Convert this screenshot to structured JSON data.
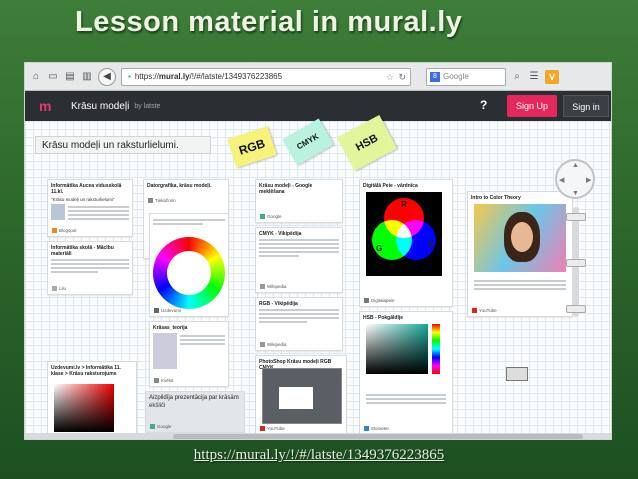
{
  "slide": {
    "title": "Lesson material in mural.ly",
    "caption_url": "https://mural.ly/!/#/latste/1349376223865"
  },
  "browser": {
    "url_prefix": "https://",
    "url_domain": "mural.ly",
    "url_rest": "/!/#/latste/1349376223865",
    "search_placeholder": "Google",
    "search_engine_letter": "8"
  },
  "mural": {
    "board_name": "Krāsu modeļi",
    "by": "by latste",
    "help": "?",
    "signup": "Sign Up",
    "signin": "Sign in",
    "board_title": "Krāsu modeļi un raksturlielumi.",
    "stickies": [
      "RGB",
      "CMYK",
      "HSB"
    ],
    "cards": {
      "c1_title": "Informātika Aucea vidusskolā 11.kl.",
      "c1_sub": "\"Krāsu modeļi un raksturlielumi\"",
      "c1_src": "Blogspot",
      "c2_title": "Informātika skolā - Mācību materiāli",
      "c2_src": "Lilu",
      "c3_title": "Datorgrafika, krāsu modeļi.",
      "c3_src": "Tiekažorin",
      "c4_src": "Uzdevumi",
      "c5_title": "Krāsas_teorija",
      "c5_src": "Kvēlot",
      "c6_title": "Krāsu modeļi - Google meklēšana",
      "c6_src": "Google",
      "c7_title": "CMYK - Vikipēdija",
      "c7_src": "Wikipedia",
      "c8_title": "RGB - Vikipēdija",
      "c8_src": "Wikipedia",
      "c9_title": "PhotoShop Krāsu modeļi RGB CMYK",
      "c9_src": "YouTube",
      "c10_title": "Digitālā Peie - vārdnīca",
      "c10_src": "Digitalapeie",
      "c11_title": "HSB - Pokgāldīje",
      "c11_src": "Slometer",
      "c12_title": "Intro to Color Theory",
      "c12_src": "YouTube",
      "c13_title": "Uzdevumi.lv > Informātika 11. klase > Krāsu raksturojums",
      "c14_title": "Aizpildīja prezentācija par krāsām",
      "c14_sub": "ekšliči",
      "c14_src": "Google"
    },
    "rgb_labels": [
      "R",
      "G",
      "B"
    ]
  }
}
